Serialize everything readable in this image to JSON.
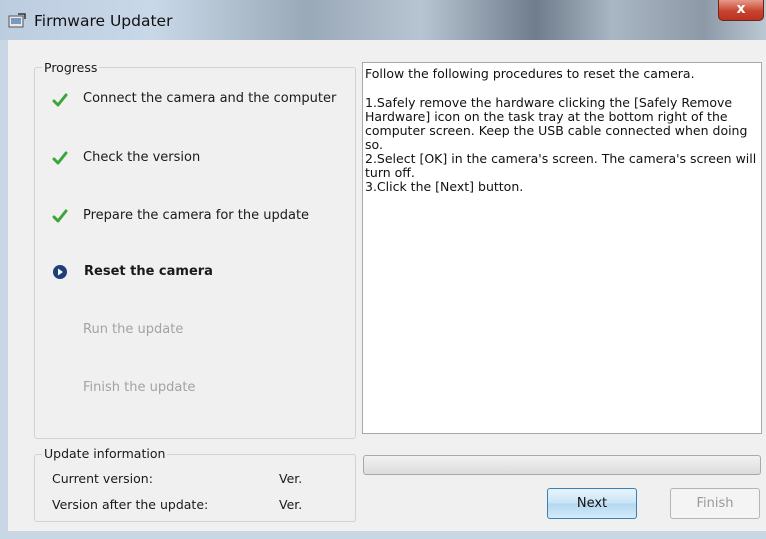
{
  "window": {
    "title": "Firmware Updater",
    "close_label": "x"
  },
  "progress": {
    "group_title": "Progress",
    "steps": [
      {
        "label": "Connect the camera and the computer",
        "state": "done"
      },
      {
        "label": "Check the version",
        "state": "done"
      },
      {
        "label": "Prepare the camera for the update",
        "state": "done"
      },
      {
        "label": "Reset the camera",
        "state": "current"
      },
      {
        "label": "Run the update",
        "state": "pending"
      },
      {
        "label": "Finish the update",
        "state": "pending"
      }
    ]
  },
  "instructions": {
    "intro": "Follow the following procedures to reset the camera.",
    "lines": [
      "1.Safely remove the hardware clicking the [Safely Remove Hardware] icon on the task tray at the bottom right of the computer screen. Keep the USB cable connected when doing so.",
      "2.Select [OK] in the camera's screen. The camera's screen will turn off.",
      "3.Click the [Next] button."
    ]
  },
  "update_info": {
    "group_title": "Update information",
    "current_label": "Current version:",
    "current_value": "Ver.",
    "after_label": "Version after the update:",
    "after_value": "Ver."
  },
  "update_progress_fraction": 0,
  "buttons": {
    "next": "Next",
    "finish": "Finish"
  },
  "colors": {
    "check": "#3aa63a",
    "current_step": "#1f3f7a",
    "pending_text": "#a3a3a3"
  },
  "icons": {
    "done": "check-icon",
    "current": "arrow-circle-icon",
    "app": "updater-app-icon"
  }
}
